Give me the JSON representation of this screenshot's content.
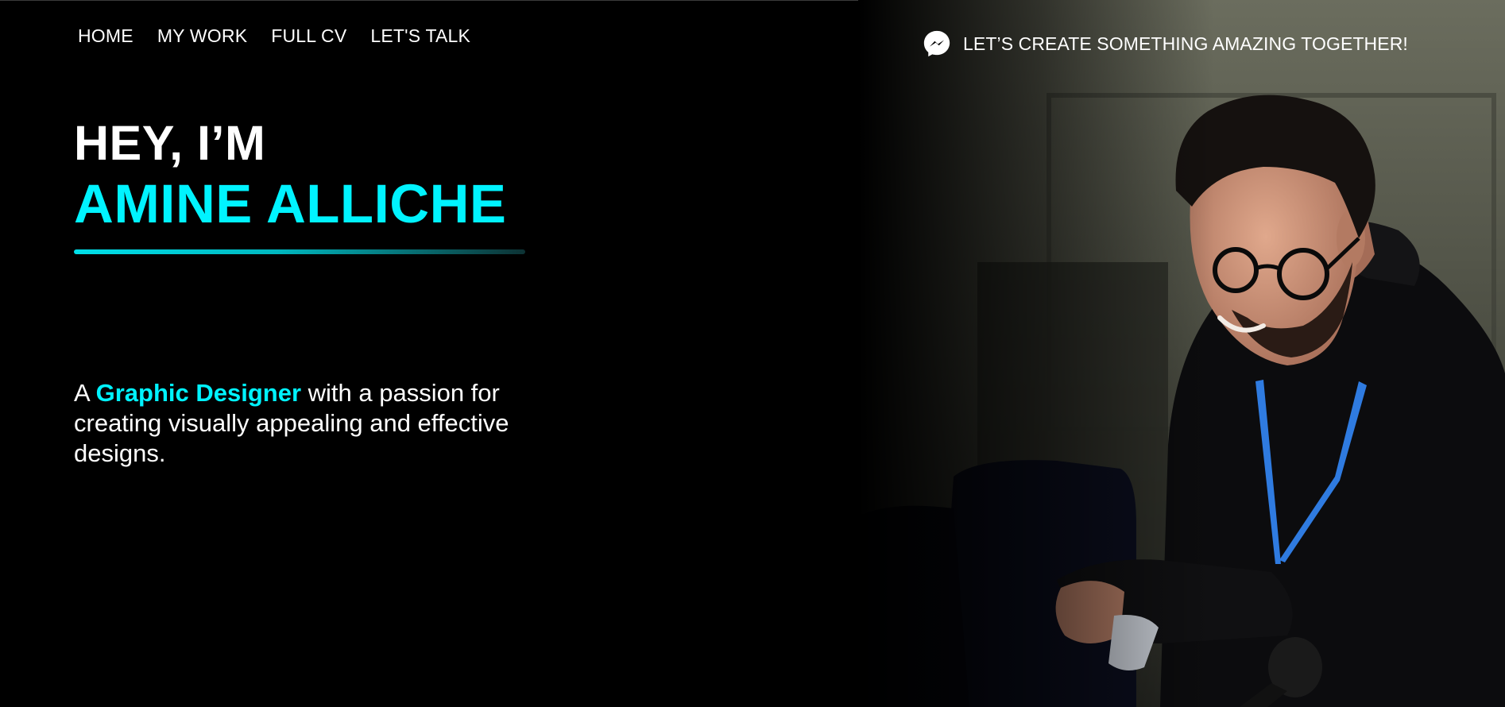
{
  "nav": {
    "items": [
      {
        "label": "HOME"
      },
      {
        "label": "MY WORK"
      },
      {
        "label": "FULL CV"
      },
      {
        "label": "LET'S TALK"
      }
    ]
  },
  "cta": {
    "icon": "messenger-icon",
    "text": "LET’S CREATE SOMETHING AMAZING TOGETHER!"
  },
  "hero": {
    "greeting": "HEY, I’M",
    "name": "AMINE ALLICHE",
    "tagline_prefix": "A ",
    "tagline_highlight": "Graphic Designer",
    "tagline_rest": " with a passion for creating visually appealing and effective designs."
  },
  "colors": {
    "accent": "#00f3ff",
    "background": "#000000",
    "text": "#ffffff"
  }
}
